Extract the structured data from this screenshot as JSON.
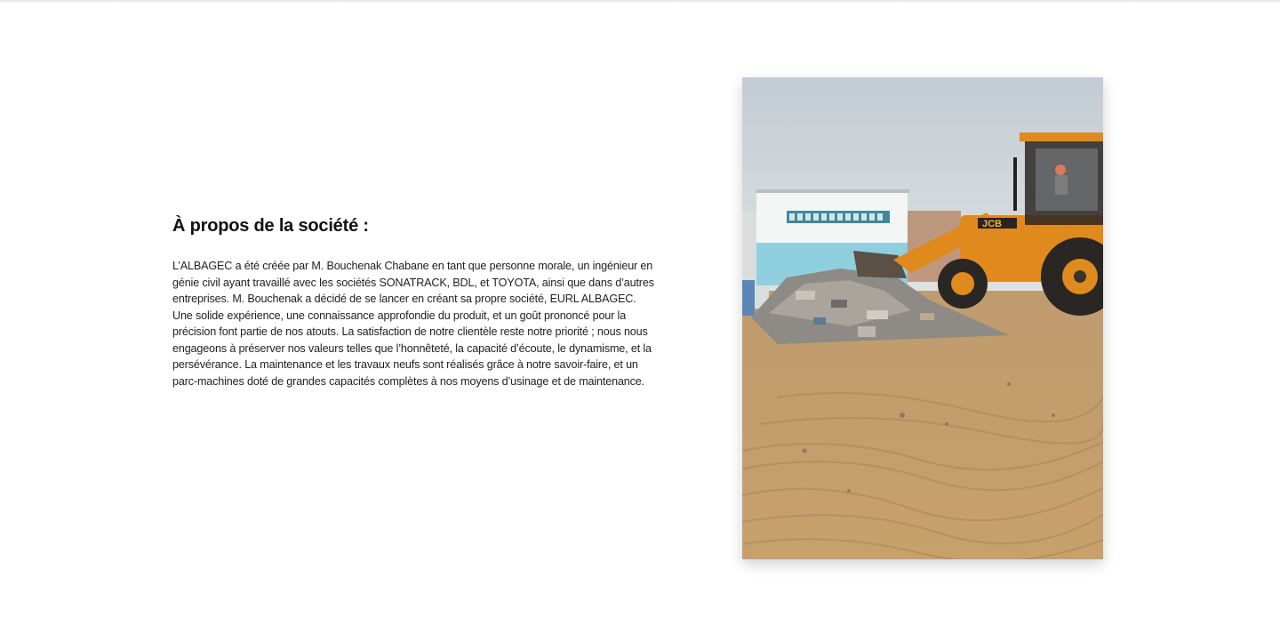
{
  "about": {
    "title": "À propos de la société :",
    "paragraph": "L’ALBAGEC a été créée par M. Bouchenak Chabane en tant que personne morale, un ingénieur en génie civil ayant travaillé avec les sociétés SONATRACK, BDL, et TOYOTA, ainsi que dans d’autres entreprises. M. Bouchenak a décidé de se lancer en créant sa propre société, EURL ALBAGEC. Une solide expérience, une connaissance approfondie du produit, et un goût prononcé pour la précision font partie de nos atouts. La satisfaction de notre clientèle reste notre priorité ; nous nous engageons à préserver nos valeurs telles que l’honnêteté, la capacité d’écoute, le dynamisme, et la persévérance. La maintenance et les travaux neufs sont réalisés grâce à notre savoir-faire, et un parc-machines doté de grandes capacités complètes à nos moyens d’usinage et de maintenance."
  },
  "photo": {
    "subject": "backhoe-loader-clearing-debris",
    "loader_brand": "JCB",
    "colors": {
      "sky": "#cfd6dc",
      "sand": "#c49d6a",
      "machine": "#e08a1e",
      "wall_blue": "#8fcfe0"
    }
  }
}
